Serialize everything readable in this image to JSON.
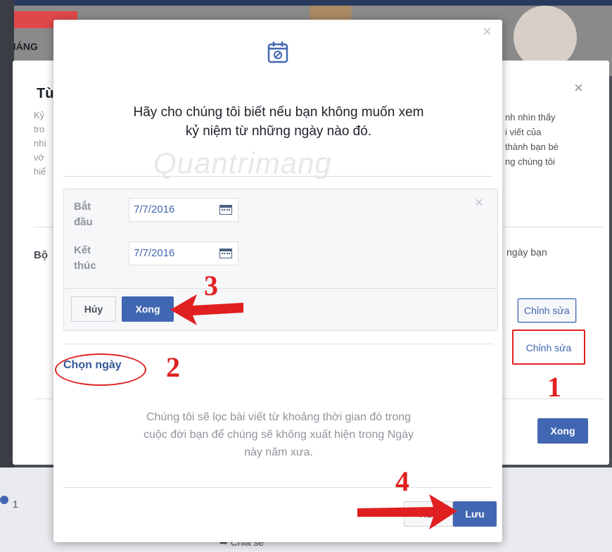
{
  "background": {
    "banner_label": "THÁNG",
    "count": "1",
    "share_label": "Chia sẻ"
  },
  "middle_dialog": {
    "title": "Tù",
    "close_glyph": "×",
    "left_text": [
      "Kỷ",
      "tro",
      "nhì",
      "vớ",
      "hiể"
    ],
    "right_text": [
      "nh nhìn thấy",
      "i viết của",
      "thành bạn bè",
      "ng chúng tôi"
    ],
    "section_label": "Bộ",
    "section_right_text": "ngày bạn",
    "edit_button_1": "Chỉnh sửa",
    "edit_button_2": "Chỉnh sửa",
    "done_button": "Xong"
  },
  "front_dialog": {
    "close_glyph": "×",
    "icon": "calendar-icon",
    "heading_line1": "Hãy cho chúng tôi biết nếu bạn không muốn xem",
    "heading_line2": "kỷ niệm từ những ngày nào đó.",
    "watermark": "Quantrimang",
    "date_panel": {
      "close_glyph": "×",
      "start_label_1": "Bắt",
      "start_label_2": "đầu",
      "start_value": "7/7/2016",
      "end_label_1": "Kết",
      "end_label_2": "thúc",
      "end_value": "7/7/2016",
      "cancel_button": "Hủy",
      "done_button": "Xong"
    },
    "choose_date_link": "Chọn ngày",
    "description_line1": "Chúng tôi sẽ lọc bài viết từ khoảng thời gian đó trong",
    "description_line2": "cuộc đời bạn để chúng sẽ không xuất hiện trong Ngày",
    "description_line3": "này năm xưa.",
    "cancel_button": "Hủy",
    "save_button": "Lưu"
  },
  "annotations": {
    "step1": "1",
    "step2": "2",
    "step3": "3",
    "step4": "4",
    "accent_color": "#e02020"
  }
}
